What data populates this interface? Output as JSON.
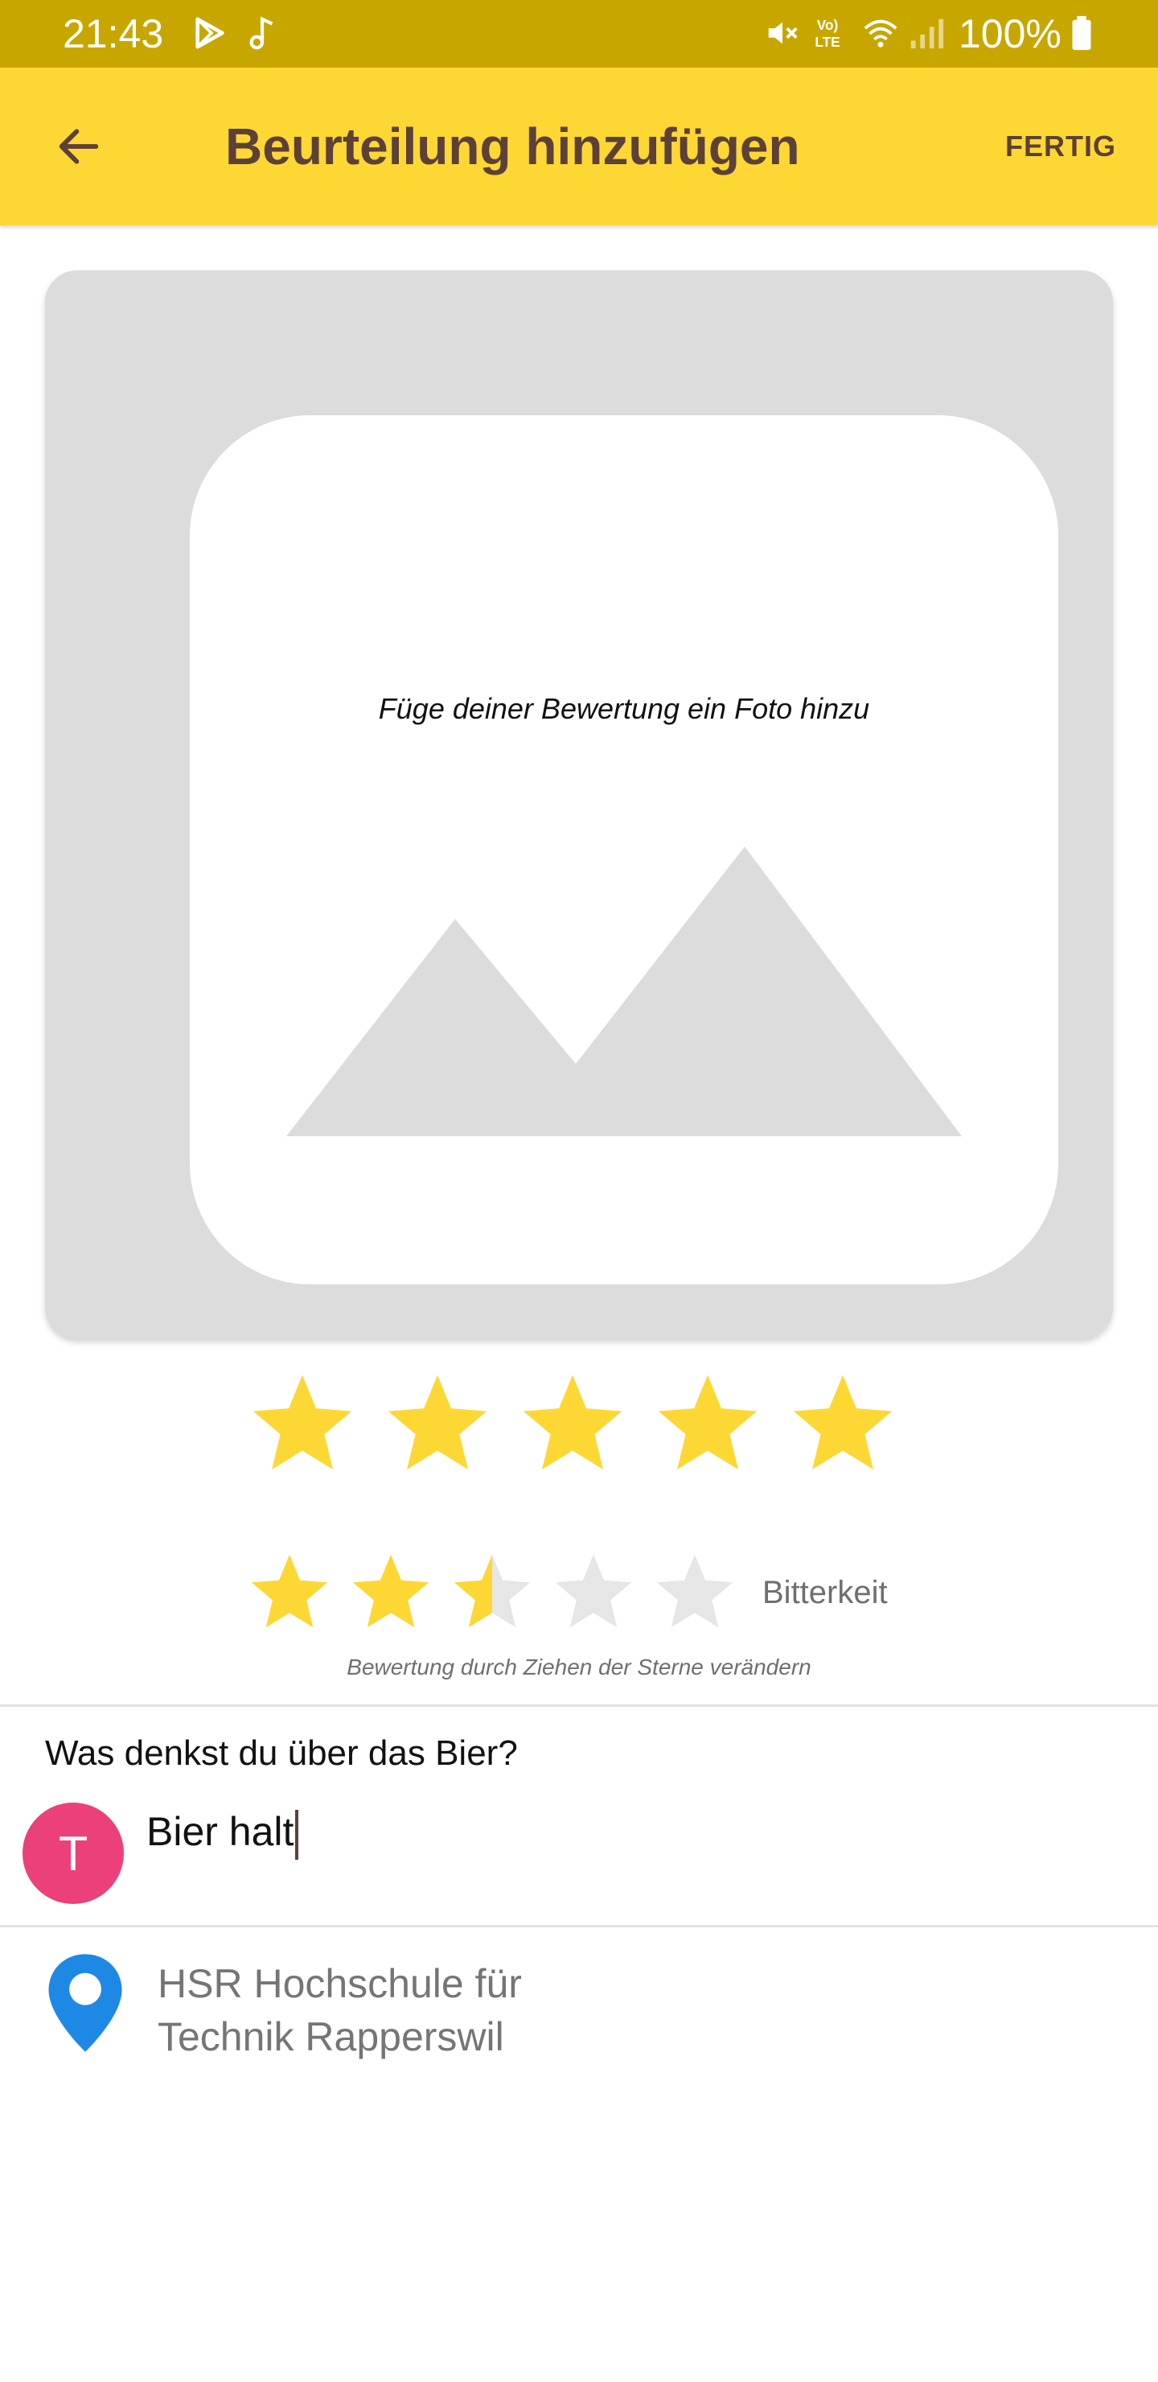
{
  "status_bar": {
    "time": "21:43",
    "battery": "100%",
    "icons": [
      "play-store-icon",
      "music-note-icon",
      "mute-icon",
      "volte-icon",
      "wifi-icon",
      "signal-icon",
      "battery-icon"
    ],
    "background_color": "#c8a600"
  },
  "app_bar": {
    "title": "Beurteilung hinzufügen",
    "done_label": "FERTIG",
    "back_icon": "arrow-left-icon",
    "background_color": "#fdd835",
    "text_color": "#5d4037"
  },
  "photo": {
    "hint": "Füge deiner Bewertung ein Foto hinzu",
    "placeholder_icon": "image-placeholder-icon"
  },
  "rating": {
    "overall_value": 5,
    "overall_max": 5,
    "bitterness_value": 2.5,
    "bitterness_max": 5,
    "bitterness_label": "Bitterkeit",
    "drag_hint": "Bewertung durch Ziehen der Sterne verändern",
    "star_color": "#fdd835",
    "empty_star_color": "#e6e6e6"
  },
  "comment": {
    "question": "Was denkst du über das Bier?",
    "avatar_initial": "T",
    "avatar_color": "#ec407a",
    "text": "Bier halt"
  },
  "location": {
    "line1": "HSR Hochschule für",
    "line2": "Technik Rapperswil",
    "icon": "map-pin-icon",
    "icon_color": "#1e88e5"
  }
}
